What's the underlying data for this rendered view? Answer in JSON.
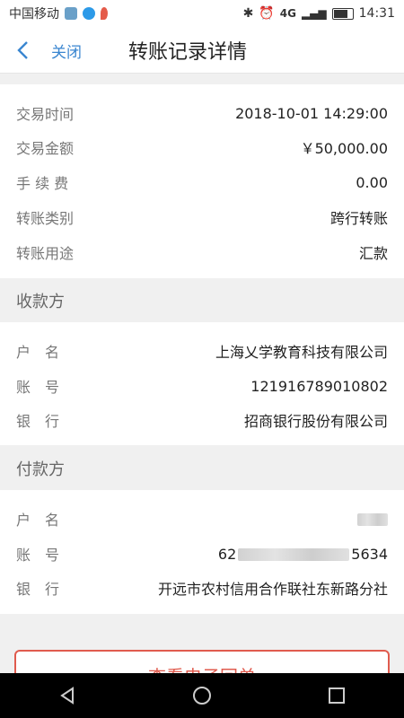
{
  "status": {
    "carrier": "中国移动",
    "network": "4G",
    "time": "14:31"
  },
  "nav": {
    "close_label": "关闭",
    "title": "转账记录详情"
  },
  "transaction": [
    {
      "label": "交易时间",
      "value": "2018-10-01 14:29:00"
    },
    {
      "label": "交易金额",
      "value": "￥50,000.00"
    },
    {
      "label": "手 续 费",
      "value": "0.00"
    },
    {
      "label": "转账类别",
      "value": "跨行转账"
    },
    {
      "label": "转账用途",
      "value": "汇款"
    }
  ],
  "payee": {
    "section_label": "收款方",
    "name_label": "户　名",
    "name": "上海乂学教育科技有限公司",
    "account_label": "账　号",
    "account": "121916789010802",
    "bank_label": "银　行",
    "bank": "招商银行股份有限公司"
  },
  "payer": {
    "section_label": "付款方",
    "name_label": "户　名",
    "account_label": "账　号",
    "account_prefix": "62",
    "account_suffix": "5634",
    "bank_label": "银　行",
    "bank": "开远市农村信用合作联社东新路分社"
  },
  "receipt_button_label": "查看电子回单",
  "colors": {
    "accent": "#3a86d0",
    "button": "#e05b4e"
  }
}
